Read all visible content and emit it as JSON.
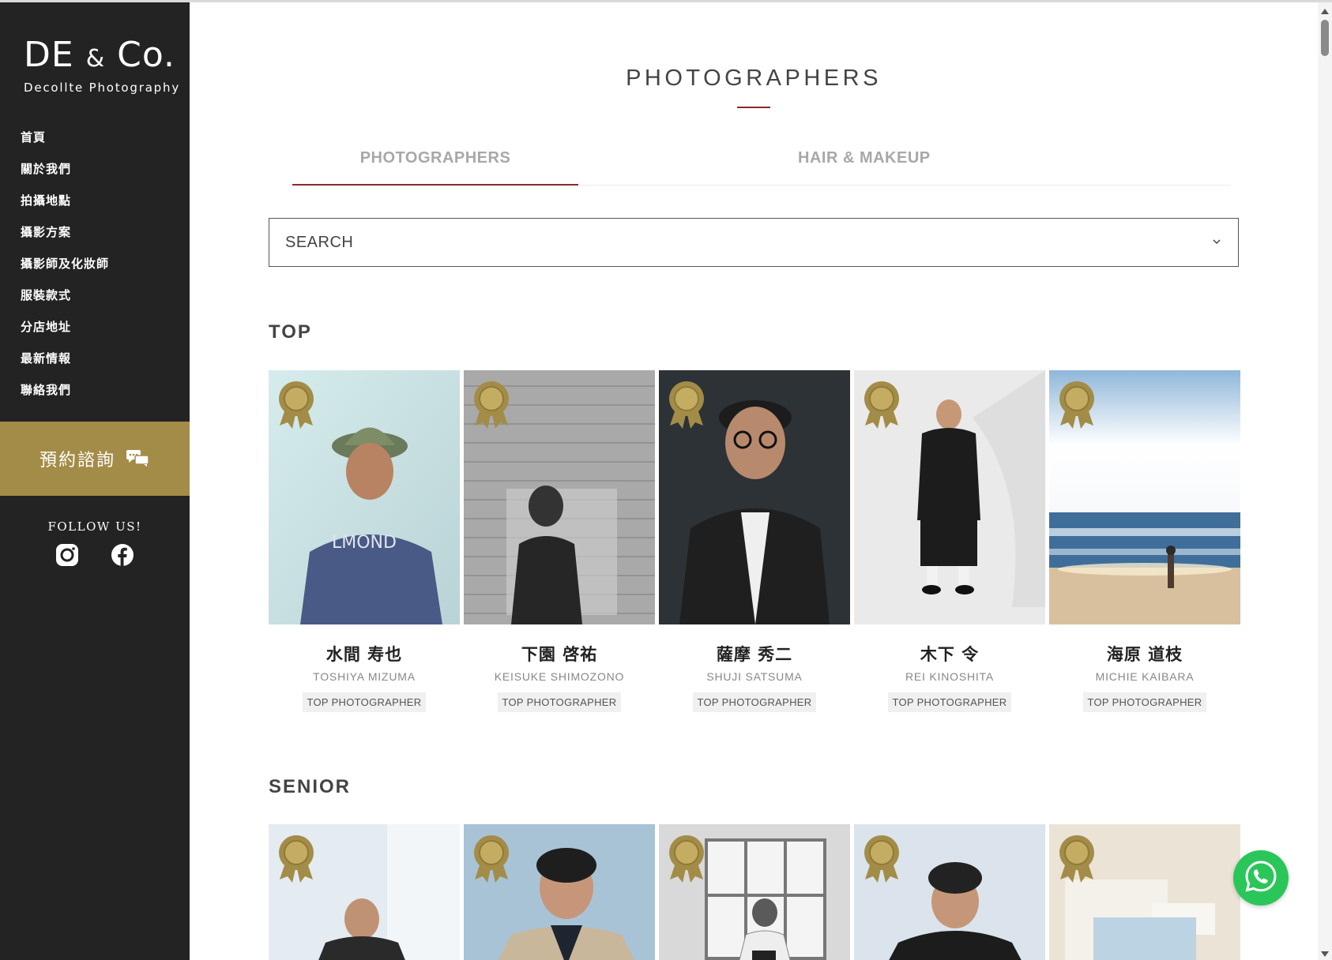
{
  "brand": {
    "logo_main": "DE",
    "logo_amp": "&",
    "logo_co": "Co.",
    "logo_sub": "Decollte Photography"
  },
  "nav": [
    {
      "label": "首頁"
    },
    {
      "label": "關於我們"
    },
    {
      "label": "拍攝地點"
    },
    {
      "label": "攝影方案"
    },
    {
      "label": "攝影師及化妝師"
    },
    {
      "label": "服裝款式"
    },
    {
      "label": "分店地址"
    },
    {
      "label": "最新情報"
    },
    {
      "label": "聯絡我們"
    }
  ],
  "booking": {
    "label": "預約諮詢",
    "icon": "chat-bubbles-icon"
  },
  "follow": {
    "title": "FOLLOW US!",
    "icons": [
      "instagram-icon",
      "facebook-icon"
    ]
  },
  "page": {
    "title": "PHOTOGRAPHERS"
  },
  "tabs": [
    {
      "label": "PHOTOGRAPHERS",
      "active": true
    },
    {
      "label": "HAIR & MAKEUP",
      "active": false
    }
  ],
  "search": {
    "placeholder": "SEARCH"
  },
  "sections": {
    "top": {
      "title": "TOP",
      "cards": [
        {
          "name_jp": "水間 寿也",
          "name_en": "TOSHIYA MIZUMA",
          "badge": "TOP PHOTOGRAPHER"
        },
        {
          "name_jp": "下園 啓祐",
          "name_en": "KEISUKE SHIMOZONO",
          "badge": "TOP PHOTOGRAPHER"
        },
        {
          "name_jp": "薩摩 秀二",
          "name_en": "SHUJI SATSUMA",
          "badge": "TOP PHOTOGRAPHER"
        },
        {
          "name_jp": "木下 令",
          "name_en": "REI KINOSHITA",
          "badge": "TOP PHOTOGRAPHER"
        },
        {
          "name_jp": "海原 道枝",
          "name_en": "MICHIE KAIBARA",
          "badge": "TOP PHOTOGRAPHER"
        }
      ]
    },
    "senior": {
      "title": "SENIOR"
    }
  },
  "colors": {
    "sidebar": "#232323",
    "gold": "#a38c47",
    "accent": "#8a2a2a",
    "whatsapp": "#2bc659"
  }
}
